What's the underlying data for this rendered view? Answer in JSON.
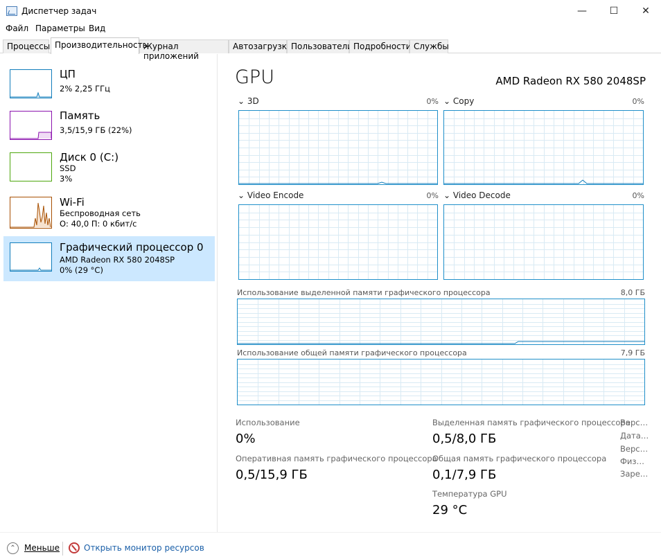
{
  "window": {
    "title": "Диспетчер задач",
    "icon": "task-manager-icon"
  },
  "menu": [
    "Файл",
    "Параметры",
    "Вид"
  ],
  "tabs": [
    "Процессы",
    "Производительность",
    "Журнал приложений",
    "Автозагрузка",
    "Пользователи",
    "Подробности",
    "Службы"
  ],
  "active_tab": "Производительность",
  "sidebar": [
    {
      "title": "ЦП",
      "line1": "2% 2,25 ГГц",
      "line2": "",
      "color": "#117dbb"
    },
    {
      "title": "Память",
      "line1": "3,5/15,9 ГБ (22%)",
      "line2": "",
      "color": "#8b12ae"
    },
    {
      "title": "Диск 0 (C:)",
      "line1": "SSD",
      "line2": "3%",
      "color": "#4da60c"
    },
    {
      "title": "Wi-Fi",
      "line1": "Беспроводная сеть",
      "line2": "О: 40,0 П: 0 кбит/с",
      "color": "#a74f01"
    },
    {
      "title": "Графический процессор 0",
      "line1": "AMD Radeon RX 580 2048SP",
      "line2": "0% (29 °C)",
      "color": "#117dbb"
    }
  ],
  "main": {
    "title": "GPU",
    "model": "AMD Radeon RX 580 2048SP",
    "engines": [
      {
        "label": "3D",
        "pct": "0%"
      },
      {
        "label": "Copy",
        "pct": "0%"
      },
      {
        "label": "Video Encode",
        "pct": "0%"
      },
      {
        "label": "Video Decode",
        "pct": "0%"
      }
    ],
    "dedicated_memory": {
      "label": "Использование выделенной памяти графического процессора",
      "max": "8,0 ГБ"
    },
    "shared_memory": {
      "label": "Использование общей памяти графического процессора",
      "max": "7,9 ГБ"
    },
    "stats": {
      "usage_label": "Использование",
      "usage_value": "0%",
      "ram_label": "Оперативная память графического процессора",
      "ram_value": "0,5/15,9 ГБ",
      "dedicated_label": "Выделенная память графического процессора",
      "dedicated_value": "0,5/8,0 ГБ",
      "shared_label": "Общая память графического процессора",
      "shared_value": "0,1/7,9 ГБ",
      "temp_label": "Температура GPU",
      "temp_value": "29 °C"
    },
    "side_stats": [
      "Верс…",
      "Дата…",
      "Верс…",
      "Физ…",
      "Заре…"
    ]
  },
  "footer": {
    "fewer": "Меньше",
    "monitor": "Открыть монитор ресурсов"
  }
}
